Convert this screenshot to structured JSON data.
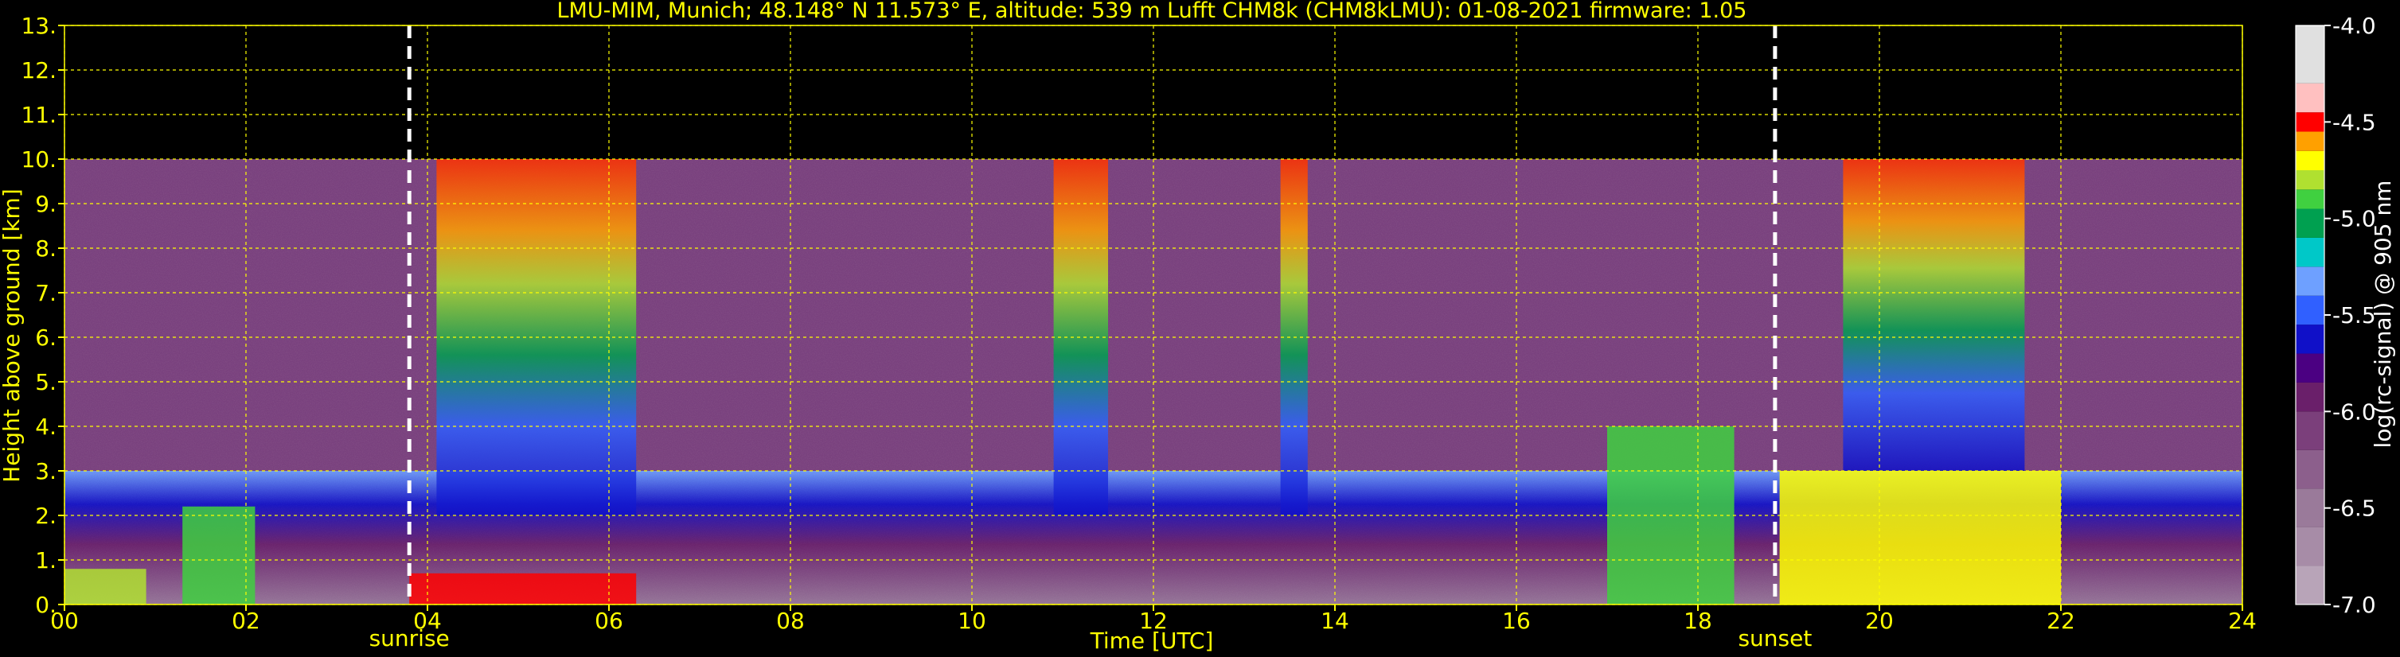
{
  "chart_data": {
    "type": "heatmap",
    "title": "LMU-MIM, Munich; 48.148° N 11.573° E, altitude: 539 m    Lufft CHM8k (CHM8kLMU): 01-08-2021    firmware: 1.05",
    "xlabel": "Time [UTC]",
    "ylabel": "Height above ground [km]",
    "xlim": [
      0,
      24
    ],
    "ylim": [
      0,
      13
    ],
    "x_ticks": [
      "00",
      "02",
      "04",
      "06",
      "08",
      "10",
      "12",
      "14",
      "16",
      "18",
      "20",
      "22",
      "24"
    ],
    "y_ticks": [
      "0.",
      "1.",
      "2.",
      "3.",
      "4.",
      "5.",
      "6.",
      "7.",
      "8.",
      "9.",
      "10.",
      "11.",
      "12.",
      "13."
    ],
    "grid": true,
    "data_top_km": 10,
    "events": [
      {
        "label": "sunrise",
        "time_h": 3.8
      },
      {
        "label": "sunset",
        "time_h": 18.85
      }
    ],
    "colorbar": {
      "label": "log(rc-signal) @ 905 nm",
      "range": [
        -7.0,
        -4.0
      ],
      "ticks": [
        "-4.0",
        "-4.5",
        "-5.0",
        "-5.5",
        "-6.0",
        "-6.5",
        "-7.0"
      ],
      "levels": [
        {
          "v": -7.0,
          "c": "#b8a4b8"
        },
        {
          "v": -6.8,
          "c": "#a78ca7"
        },
        {
          "v": -6.6,
          "c": "#9a7a9a"
        },
        {
          "v": -6.4,
          "c": "#8c5f8c"
        },
        {
          "v": -6.2,
          "c": "#7b3f7b"
        },
        {
          "v": -6.0,
          "c": "#6a1f6a"
        },
        {
          "v": -5.85,
          "c": "#4b0082"
        },
        {
          "v": -5.7,
          "c": "#1010c8"
        },
        {
          "v": -5.55,
          "c": "#3060ff"
        },
        {
          "v": -5.4,
          "c": "#6ea0ff"
        },
        {
          "v": -5.25,
          "c": "#00c8c8"
        },
        {
          "v": -5.1,
          "c": "#00a050"
        },
        {
          "v": -4.95,
          "c": "#40d040"
        },
        {
          "v": -4.85,
          "c": "#b0e030"
        },
        {
          "v": -4.75,
          "c": "#ffff00"
        },
        {
          "v": -4.65,
          "c": "#ffa000"
        },
        {
          "v": -4.55,
          "c": "#ff0000"
        },
        {
          "v": -4.45,
          "c": "#ffc0c0"
        },
        {
          "v": -4.3,
          "c": "#e0e0e0"
        },
        {
          "v": -4.0,
          "c": "#ffffff"
        }
      ]
    },
    "layers": [
      {
        "name": "noise-background",
        "from_h": 0,
        "to_h": 24,
        "bottom_km": 3,
        "top_km": 10,
        "level": -6.2
      },
      {
        "name": "low-boundary-layer",
        "from_h": 0,
        "to_h": 24,
        "bottom_km": 0,
        "top_km": 3,
        "level": -6.0
      },
      {
        "name": "aerosol-layer-morning",
        "from_h": 0,
        "to_h": 0.9,
        "bottom_km": 0,
        "top_km": 0.8,
        "level": -4.8
      },
      {
        "name": "aerosol-layer-night",
        "from_h": 1.3,
        "to_h": 2.1,
        "bottom_km": 0,
        "top_km": 2.2,
        "level": -4.9
      },
      {
        "name": "fog-layer",
        "from_h": 3.8,
        "to_h": 6.3,
        "bottom_km": 0,
        "top_km": 0.7,
        "level": -4.5
      },
      {
        "name": "noise-plume-1",
        "from_h": 4.1,
        "to_h": 6.3,
        "bottom_km": 2,
        "top_km": 10,
        "level": -5.0
      },
      {
        "name": "noise-plume-2",
        "from_h": 10.9,
        "to_h": 11.5,
        "bottom_km": 2,
        "top_km": 10,
        "level": -4.7
      },
      {
        "name": "noise-plume-3",
        "from_h": 13.4,
        "to_h": 13.7,
        "bottom_km": 2,
        "top_km": 10,
        "level": -4.7
      },
      {
        "name": "convective-clouds",
        "from_h": 17.0,
        "to_h": 18.4,
        "bottom_km": 0,
        "top_km": 4,
        "level": -4.9
      },
      {
        "name": "evening-layer",
        "from_h": 18.9,
        "to_h": 22.0,
        "bottom_km": 0,
        "top_km": 3,
        "level": -4.7
      },
      {
        "name": "upper-plume-evening",
        "from_h": 19.6,
        "to_h": 21.6,
        "bottom_km": 3,
        "top_km": 10,
        "level": -5.0
      }
    ]
  }
}
